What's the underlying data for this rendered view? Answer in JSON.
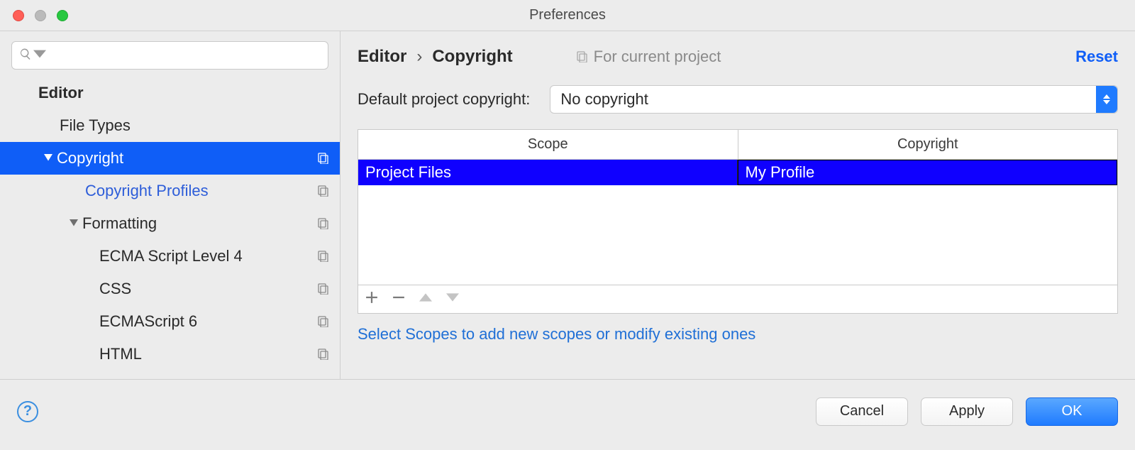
{
  "window": {
    "title": "Preferences"
  },
  "sidebar": {
    "search_placeholder": "",
    "items": {
      "editor": "Editor",
      "file_types": "File Types",
      "copyright": "Copyright",
      "copyright_profiles": "Copyright Profiles",
      "formatting": "Formatting",
      "ecma4": "ECMA Script Level 4",
      "css": "CSS",
      "ecma6": "ECMAScript 6",
      "html": "HTML"
    }
  },
  "breadcrumb": {
    "root": "Editor",
    "sep": "›",
    "leaf": "Copyright"
  },
  "for_current": "For current project",
  "reset": "Reset",
  "default_copyright": {
    "label": "Default project copyright:",
    "value": "No copyright"
  },
  "table": {
    "columns": {
      "scope": "Scope",
      "copyright": "Copyright"
    },
    "rows": [
      {
        "scope": "Project Files",
        "copyright": "My Profile"
      }
    ]
  },
  "hint": "Select Scopes to add new scopes or modify existing ones",
  "footer": {
    "cancel": "Cancel",
    "apply": "Apply",
    "ok": "OK"
  }
}
